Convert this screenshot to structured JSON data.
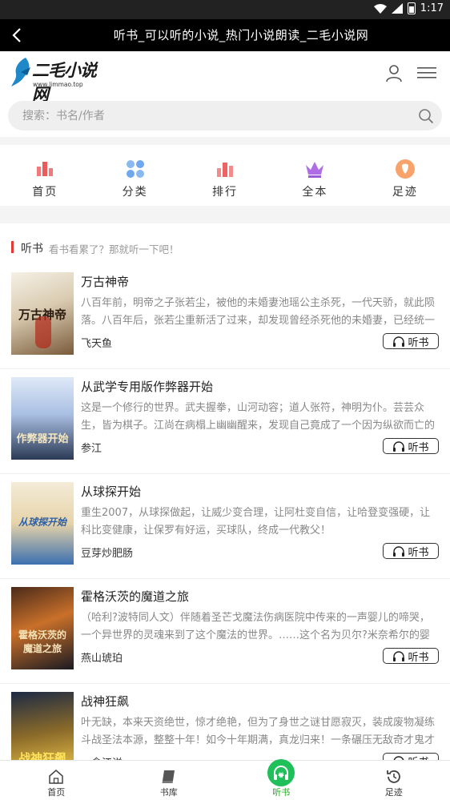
{
  "status_bar": {
    "time": "1:17"
  },
  "title_bar": {
    "title": "听书_可以听的小说_热门小说朗读_二毛小说网"
  },
  "header": {
    "logo_text": "二毛小说网",
    "logo_url": "www.limmao.top"
  },
  "search": {
    "placeholder": "搜索：书名/作者"
  },
  "nav": [
    {
      "label": "首页",
      "icon": "chart-red-icon"
    },
    {
      "label": "分类",
      "icon": "grid-dots-icon"
    },
    {
      "label": "排行",
      "icon": "rank-bars-icon"
    },
    {
      "label": "全本",
      "icon": "crown-icon"
    },
    {
      "label": "足迹",
      "icon": "footprint-icon"
    }
  ],
  "section": {
    "title": "听书",
    "subtitle": "看书看累了？那就听一下吧！"
  },
  "books": [
    {
      "title": "万古神帝",
      "desc": "八百年前，明帝之子张若尘，被他的未婚妻池瑶公主杀死，一代天骄，就此陨落。八百年后，张若尘重新活了过来，却发现曾经杀死他的未婚妻，已经统一昆仑界",
      "author": "飞天鱼",
      "cover_text": "万古神帝",
      "listen": "听书"
    },
    {
      "title": "从武学专用版作弊器开始",
      "desc": "这是一个修行的世界。武夫握拳，山河动容；道人张符，神明为仆。芸芸众生，皆为棋子。江尚在病榻上幽幽醒来，发现自己竟成了一个因为纵欲而亡的纨绔",
      "author": "参江",
      "cover_text": "作弊器开始",
      "listen": "听书"
    },
    {
      "title": "从球探开始",
      "desc": "重生2007，从球探做起，让威少变合理，让阿杜变自信，让哈登变强硬，让科比变健康，让保罗有好运，买球队，终成一代教父！",
      "author": "豆芽炒肥肠",
      "cover_text": "从球探开始",
      "listen": "听书"
    },
    {
      "title": "霍格沃茨的魔道之旅",
      "desc": "（哈利?波特同人文）伴随着圣芒戈魔法伤病医院中传来的一声婴儿的啼哭，一个异世界的灵魂来到了这个魔法的世界。……这个名为贝尔?米奈希尔的婴儿",
      "author": "燕山琥珀",
      "cover_text": "霍格沃茨的魔道之旅",
      "listen": "听书"
    },
    {
      "title": "战神狂飙",
      "desc": "叶无缺，本来天资绝世，惊才绝艳，但为了身世之谜甘愿寂灭，装成废物凝练斗战圣法本源，整整十年！如今十年期满，真龙归来！一条碾压无敌奇才鬼才",
      "author": "一念江洋",
      "cover_text": "战神狂飙",
      "listen": "听书"
    }
  ],
  "tabs": [
    {
      "label": "首页",
      "icon": "home-icon"
    },
    {
      "label": "书库",
      "icon": "book-icon"
    },
    {
      "label": "听书",
      "icon": "headphones-icon"
    },
    {
      "label": "足迹",
      "icon": "history-icon"
    }
  ],
  "colors": {
    "accent_green": "#1aad19",
    "section_bar": "#e53935",
    "titlebar_bg": "#000000"
  }
}
